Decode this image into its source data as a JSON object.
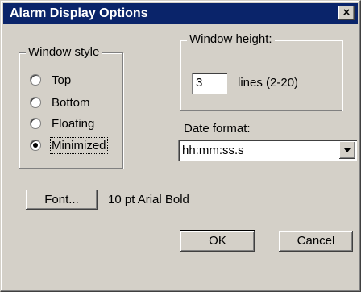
{
  "window": {
    "title": "Alarm Display Options",
    "close_glyph": "×"
  },
  "window_style": {
    "legend": "Window style",
    "options": [
      {
        "label": "Top",
        "checked": false
      },
      {
        "label": "Bottom",
        "checked": false
      },
      {
        "label": "Floating",
        "checked": false
      },
      {
        "label": "Minimized",
        "checked": true
      }
    ]
  },
  "window_height": {
    "legend": "Window height:",
    "value": "3",
    "units": "lines (2-20)"
  },
  "date_format": {
    "label": "Date format:",
    "value": "hh:mm:ss.s"
  },
  "font": {
    "button_label": "Font...",
    "current": "10 pt Arial Bold"
  },
  "buttons": {
    "ok": "OK",
    "cancel": "Cancel"
  }
}
